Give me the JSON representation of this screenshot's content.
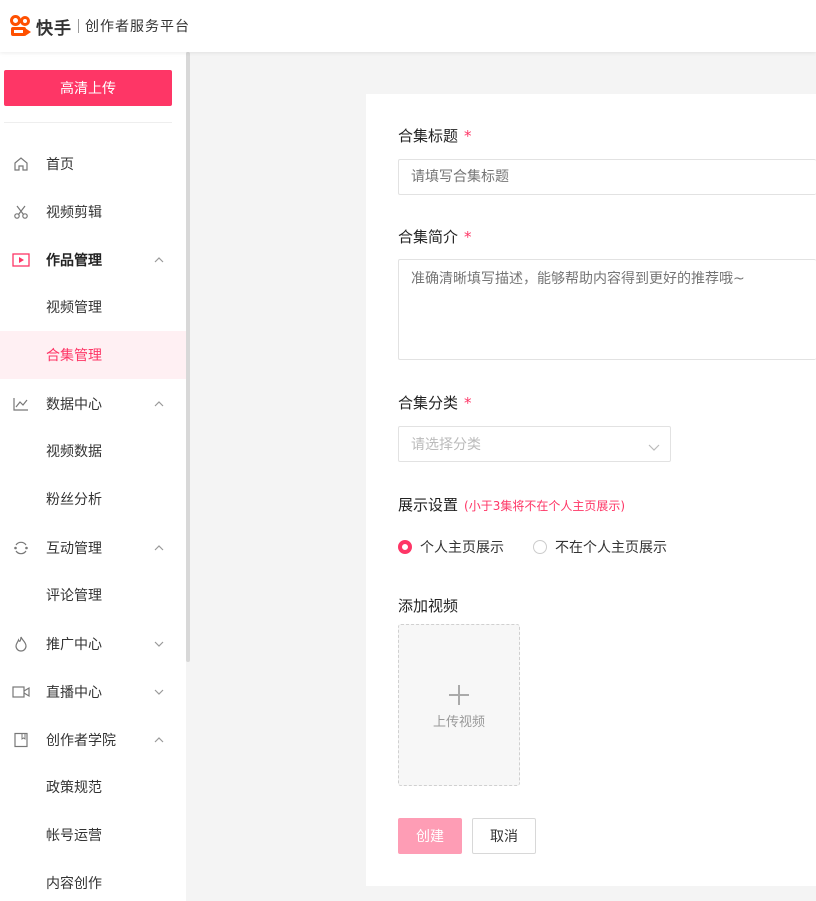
{
  "header": {
    "brand": "快手",
    "subtitle": "创作者服务平台"
  },
  "sidebar": {
    "upload_button": "高清上传",
    "items": [
      {
        "label": "首页",
        "icon": "home-icon"
      },
      {
        "label": "视频剪辑",
        "icon": "scissors-icon"
      },
      {
        "label": "作品管理",
        "icon": "video-play-icon",
        "expanded": true
      },
      {
        "label": "视频管理"
      },
      {
        "label": "合集管理",
        "active": true
      },
      {
        "label": "数据中心",
        "icon": "chart-icon",
        "expanded": true
      },
      {
        "label": "视频数据"
      },
      {
        "label": "粉丝分析"
      },
      {
        "label": "互动管理",
        "icon": "interaction-icon",
        "expanded": true
      },
      {
        "label": "评论管理"
      },
      {
        "label": "推广中心",
        "icon": "flame-icon",
        "expanded": false
      },
      {
        "label": "直播中心",
        "icon": "camera-icon",
        "expanded": false
      },
      {
        "label": "创作者学院",
        "icon": "book-icon",
        "expanded": true
      },
      {
        "label": "政策规范"
      },
      {
        "label": "帐号运营"
      },
      {
        "label": "内容创作"
      }
    ]
  },
  "form": {
    "title_label": "合集标题",
    "title_placeholder": "请填写合集标题",
    "desc_label": "合集简介",
    "desc_placeholder": "准确清晰填写描述，能够帮助内容得到更好的推荐哦~",
    "category_label": "合集分类",
    "category_placeholder": "请选择分类",
    "display_label": "展示设置",
    "display_hint": "(小于3集将不在个人主页展示)",
    "option_show": "个人主页展示",
    "option_hide": "不在个人主页展示",
    "selected_option": "个人主页展示",
    "add_video_label": "添加视频",
    "upload_video": "上传视频",
    "required_mark": "*",
    "create_button": "创建",
    "cancel_button": "取消"
  },
  "colors": {
    "accent": "#fe3666",
    "brand_orange": "#ff5000"
  }
}
